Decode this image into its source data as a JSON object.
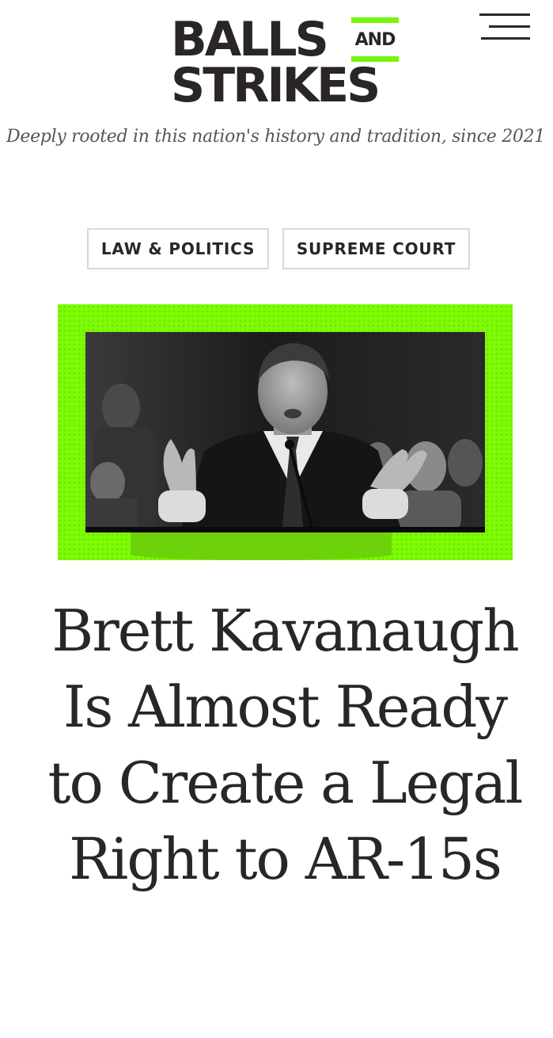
{
  "header": {
    "logo": {
      "line1": "BALLS",
      "and": "AND",
      "line2": "STRIKES"
    },
    "menu_icon": "hamburger-menu-icon",
    "tagline": "Deeply rooted in this nation's history and tradition, since 2021"
  },
  "tags": [
    {
      "label": "LAW & POLITICS"
    },
    {
      "label": "SUPREME COURT"
    }
  ],
  "hero": {
    "frame_color": "#7efc05",
    "photo_style": "black-and-white"
  },
  "article": {
    "headline": "Brett Kavanaugh Is Almost Ready to Create a Legal Right to AR-15s"
  },
  "colors": {
    "brand_green": "#76f608",
    "text": "#2b2626",
    "tag_border": "#d8d8d8"
  }
}
